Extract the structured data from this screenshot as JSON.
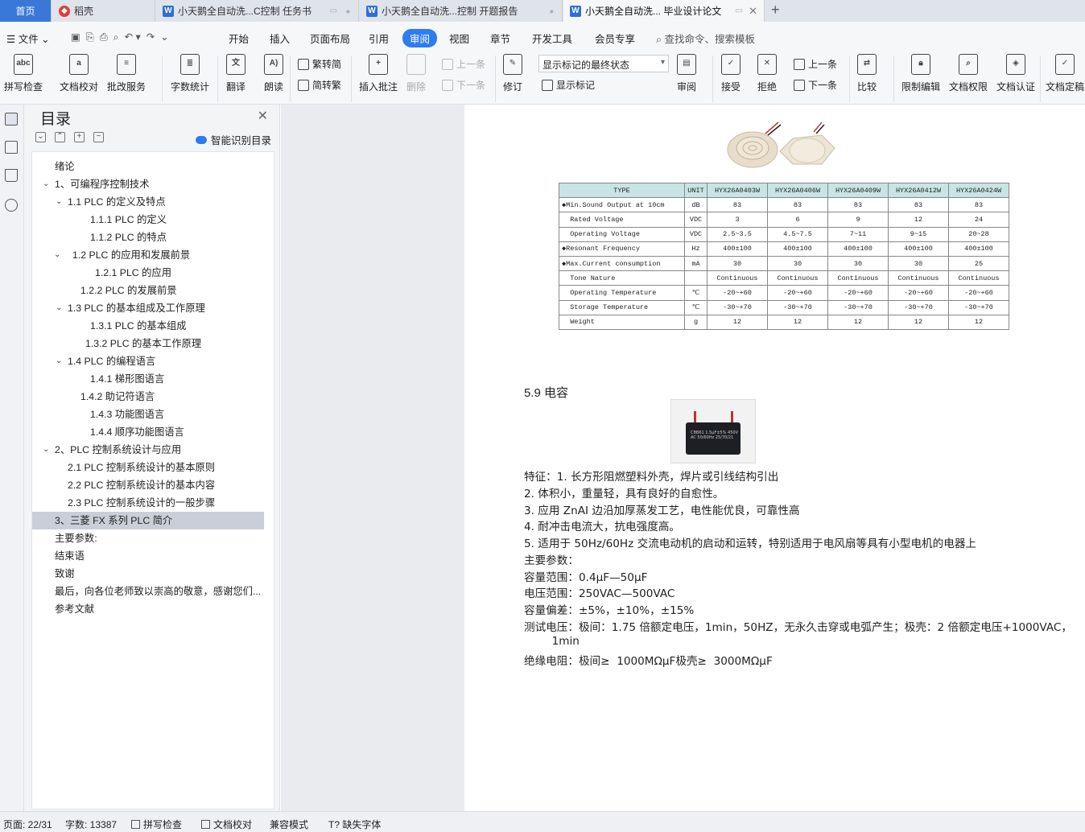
{
  "tabs": {
    "home": "首页",
    "t1": "稻壳",
    "t2": "小天鹅全自动洗...C控制 任务书",
    "t3": "小天鹅全自动洗...控制 开题报告",
    "t4": "小天鹅全自动洗... 毕业设计论文",
    "plus": "+"
  },
  "menu": {
    "file": "文件",
    "items": [
      "开始",
      "插入",
      "页面布局",
      "引用",
      "审阅",
      "视图",
      "章节",
      "开发工具",
      "会员专享"
    ],
    "search": "查找命令、搜索模板"
  },
  "ribbon": {
    "spell": "拼写检查",
    "proof": "文档校对",
    "batch": "批改服务",
    "count": "字数统计",
    "translate": "翻译",
    "read": "朗读",
    "t2s": "繁转简",
    "s2t": "简转繁",
    "insert_comment": "插入批注",
    "delete": "删除",
    "prev": "上一条",
    "next": "下一条",
    "revise": "修订",
    "show_state": "显示标记的最终状态",
    "show_marks": "显示标记",
    "review": "审阅",
    "accept": "接受",
    "reject": "拒绝",
    "prev2": "上一条",
    "next2": "下一条",
    "compare": "比较",
    "restrict": "限制编辑",
    "rights": "文档权限",
    "certify": "文档认证",
    "final": "文档定稿"
  },
  "toc": {
    "title": "目录",
    "smart": "智能识别目录",
    "items": [
      {
        "text": "绪论",
        "indent": 0
      },
      {
        "text": "1、可编程序控制技术",
        "indent": 0
      },
      {
        "text": "1.1     PLC 的定义及特点",
        "indent": 1
      },
      {
        "text": "1.1.1     PLC 的定义",
        "indent": 2
      },
      {
        "text": "1.1.2    PLC 的特点",
        "indent": 2
      },
      {
        "text": "1.2       PLC 的应用和发展前景",
        "indent": 1
      },
      {
        "text": "1.2.1    PLC 的应用",
        "indent": 2
      },
      {
        "text": "1.2.2    PLC 的发展前景",
        "indent": 2
      },
      {
        "text": "1.3    PLC 的基本组成及工作原理",
        "indent": 1
      },
      {
        "text": "1.3.1 PLC 的基本组成",
        "indent": 2
      },
      {
        "text": "1.3.2    PLC 的基本工作原理",
        "indent": 2
      },
      {
        "text": "1.4    PLC 的编程语言",
        "indent": 1
      },
      {
        "text": "1.4.1  梯形图语言",
        "indent": 2
      },
      {
        "text": "1.4.2  助记符语言",
        "indent": 2
      },
      {
        "text": "1.4.3  功能图语言",
        "indent": 2
      },
      {
        "text": "1.4.4 顺序功能图语言",
        "indent": 2
      },
      {
        "text": "2、PLC 控制系统设计与应用",
        "indent": 0
      },
      {
        "text": "2.1    PLC 控制系统设计的基本原则",
        "indent": 1
      },
      {
        "text": "2.2    PLC 控制系统设计的基本内容",
        "indent": 1
      },
      {
        "text": "2.3    PLC 控制系统设计的一般步骤",
        "indent": 1
      },
      {
        "text": "3、三菱 FX 系列 PLC 简介",
        "indent": 0
      },
      {
        "text": "主要参数:",
        "indent": 0
      },
      {
        "text": "结束语",
        "indent": 0
      },
      {
        "text": "致谢",
        "indent": 0
      },
      {
        "text": "最后，向各位老师致以崇高的敬意，感谢您们...",
        "indent": 0
      },
      {
        "text": "参考文献",
        "indent": 0
      }
    ]
  },
  "spec_table": {
    "header": [
      "TYPE",
      "UNIT",
      "HYX26A0403W",
      "HYX26A0406W",
      "HYX26A0409W",
      "HYX26A0412W",
      "HYX26A0424W"
    ],
    "rows": [
      [
        "◆Min.Sound Output at 10cm",
        "dB",
        "83",
        "83",
        "83",
        "83",
        "83"
      ],
      [
        "  Rated Voltage",
        "VDC",
        "3",
        "6",
        "9",
        "12",
        "24"
      ],
      [
        "  Operating Voltage",
        "VDC",
        "2.5~3.5",
        "4.5~7.5",
        "7~11",
        "9~15",
        "20~28"
      ],
      [
        "◆Resonant Frequency",
        "Hz",
        "400±100",
        "400±100",
        "400±100",
        "400±100",
        "400±100"
      ],
      [
        "◆Max.Current consumption",
        "mA",
        "30",
        "30",
        "30",
        "30",
        "25"
      ],
      [
        "  Tone Nature",
        "",
        "Continuous",
        "Continuous",
        "Continuous",
        "Continuous",
        "Continuous"
      ],
      [
        "  Operating Temperature",
        "℃",
        "-20~+60",
        "-20~+60",
        "-20~+60",
        "-20~+60",
        "-20~+60"
      ],
      [
        "  Storage Temperature",
        "℃",
        "-30~+70",
        "-30~+70",
        "-30~+70",
        "-30~+70",
        "-30~+70"
      ],
      [
        "  Weight",
        "g",
        "12",
        "12",
        "12",
        "12",
        "12"
      ]
    ]
  },
  "doc": {
    "section": "5.9    电容",
    "cap_label": "CBB61 1.5μF±5% 450V AC 50/60Hz 25/70/21",
    "lines": [
      "特征：1. 长方形阻燃塑料外壳，焊片或引线结构引出",
      "2. 体积小，重量轻，具有良好的自愈性。",
      "3. 应用 ZnAI 边沿加厚蒸发工艺，电性能优良，可靠性高",
      "4. 耐冲击电流大，抗电强度高。",
      "5. 适用于 50Hz/60Hz 交流电动机的启动和运转，特别适用于电风扇等具有小型电机的电器上",
      "主要参数：",
      "容量范围：0.4μF—50μF",
      "电压范围：250VAC—500VAC",
      "容量偏差：±5%，±10%，±15%",
      "测试电压：极间：1.75 倍额定电压，1min，50HZ，无永久击穿或电弧产生；极壳：2 倍额定电压+1000VAC，",
      "        1min",
      "绝缘电阻：极间≥  1000MΩμF极壳≥  3000MΩμF"
    ]
  },
  "status": {
    "page": "页面: 22/31",
    "words": "字数: 13387",
    "spell": "拼写检查",
    "proof": "文档校对",
    "compat": "兼容模式",
    "font": "缺失字体"
  },
  "colors": {
    "accent": "#2f7bf0",
    "home_tab": "#3a78d8"
  }
}
